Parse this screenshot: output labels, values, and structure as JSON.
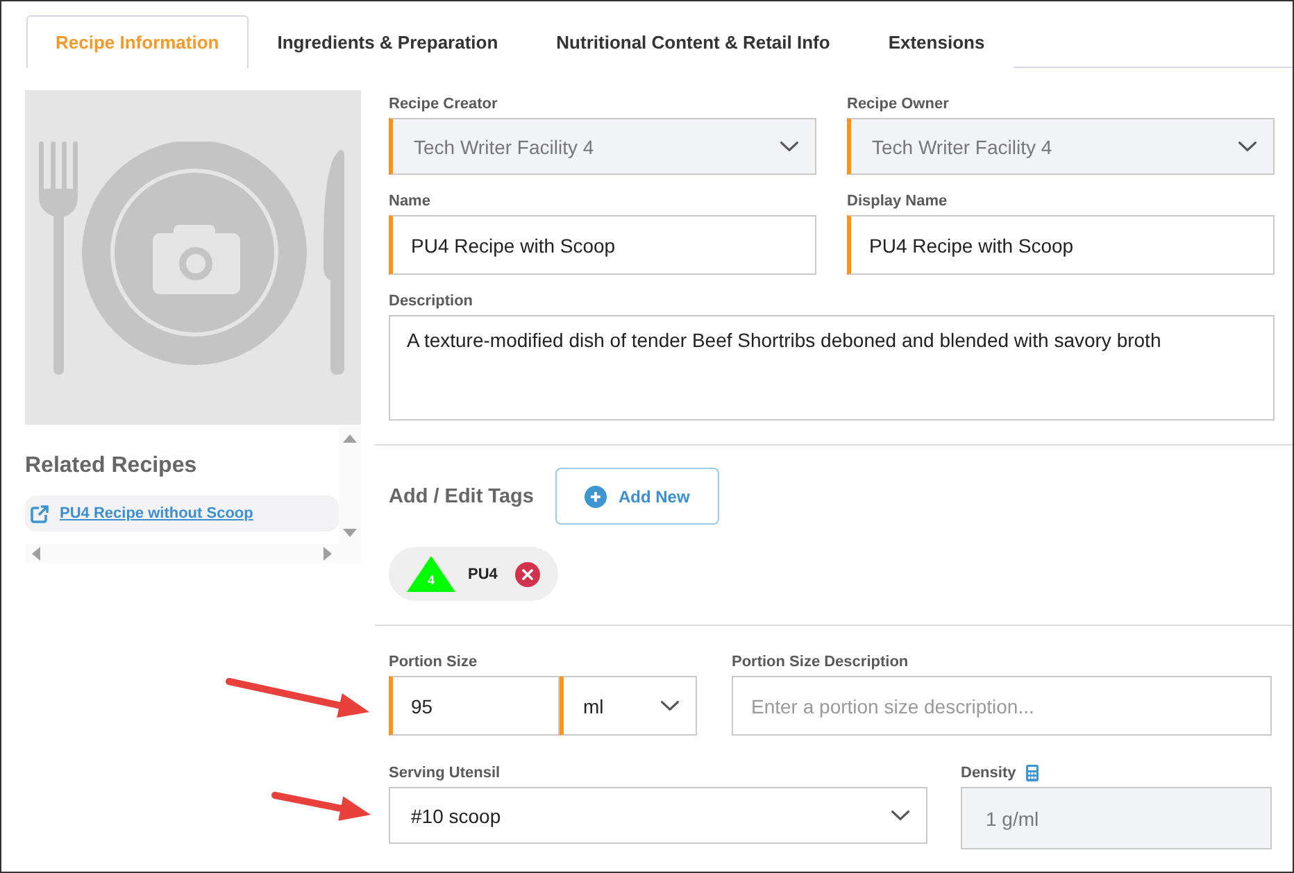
{
  "tabs": [
    {
      "label": "Recipe Information",
      "selected": true
    },
    {
      "label": "Ingredients & Preparation",
      "selected": false
    },
    {
      "label": "Nutritional Content & Retail Info",
      "selected": false
    },
    {
      "label": "Extensions",
      "selected": false
    }
  ],
  "related_recipes": {
    "title": "Related Recipes",
    "items": [
      {
        "label": "PU4 Recipe without Scoop"
      }
    ]
  },
  "form": {
    "recipe_creator": {
      "label": "Recipe Creator",
      "value": "Tech Writer Facility 4",
      "required": true,
      "disabled": true
    },
    "recipe_owner": {
      "label": "Recipe Owner",
      "value": "Tech Writer Facility 4",
      "required": true,
      "disabled": true
    },
    "name": {
      "label": "Name",
      "value": "PU4 Recipe with Scoop",
      "required": true,
      "disabled": false
    },
    "display_name": {
      "label": "Display Name",
      "value": "PU4 Recipe with Scoop",
      "required": true,
      "disabled": false
    },
    "description": {
      "label": "Description",
      "value": "A texture-modified dish of tender Beef Shortribs deboned and blended with savory broth",
      "required": false,
      "disabled": false
    }
  },
  "tags": {
    "title": "Add / Edit Tags",
    "add_button": "Add New",
    "items": [
      {
        "label": "PU4",
        "badge": "4",
        "color": "#00ff00"
      }
    ]
  },
  "portion": {
    "size": {
      "label": "Portion Size",
      "value": "95",
      "required": true,
      "disabled": false
    },
    "unit": {
      "value": "ml",
      "required": true,
      "disabled": false
    },
    "description": {
      "label": "Portion Size Description",
      "placeholder": "Enter a portion size description...",
      "required": false,
      "disabled": false
    }
  },
  "serving_utensil": {
    "label": "Serving Utensil",
    "value": "#10 scoop",
    "required": false,
    "disabled": false
  },
  "density": {
    "label": "Density",
    "value": "1 g/ml",
    "required": false,
    "disabled": true
  }
}
